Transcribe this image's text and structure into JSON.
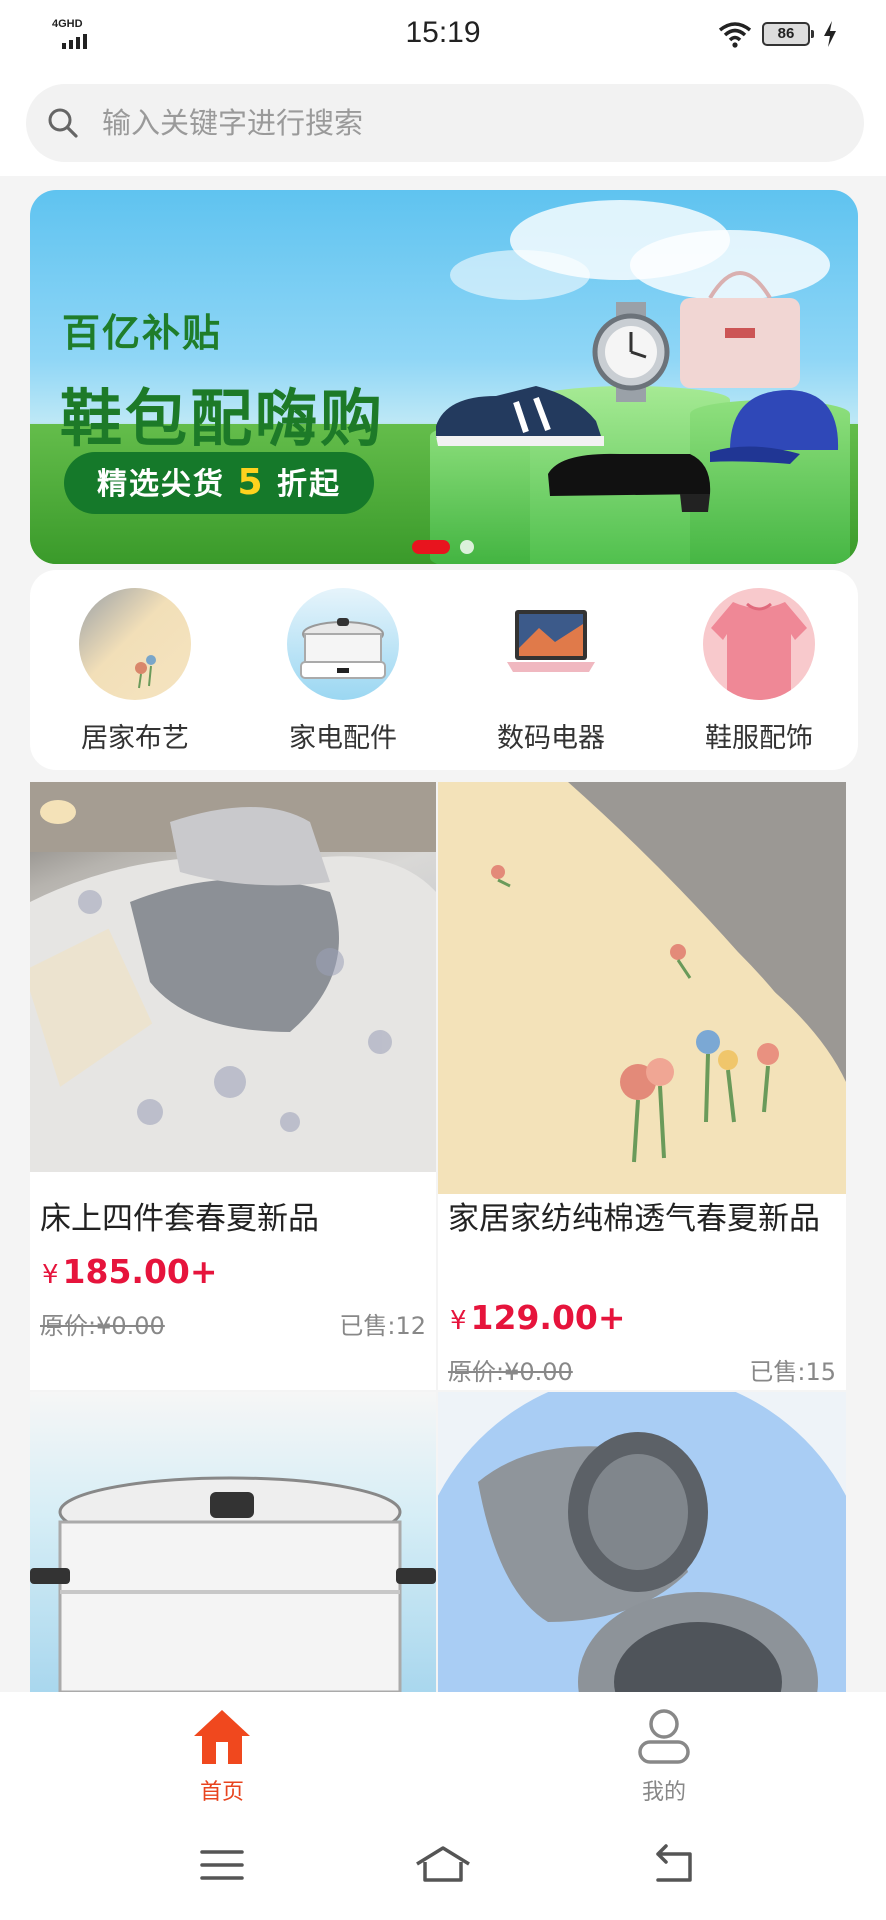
{
  "status_bar": {
    "network": "4GHD",
    "time": "15:19",
    "battery": "86"
  },
  "search": {
    "placeholder": "输入关键字进行搜索"
  },
  "banner": {
    "tag": "百亿补贴",
    "title": "鞋包配嗨购",
    "cta_prefix": "精选尖货",
    "cta_highlight": "5",
    "cta_suffix": "折起",
    "active_slide": 1,
    "slide_count": 2
  },
  "categories": [
    {
      "label": "居家布艺",
      "icon": "bedding-icon"
    },
    {
      "label": "家电配件",
      "icon": "hotpot-icon"
    },
    {
      "label": "数码电器",
      "icon": "laptop-icon"
    },
    {
      "label": "鞋服配饰",
      "icon": "sweater-icon"
    }
  ],
  "products": [
    {
      "title": "床上四件套春夏新品",
      "currency": "¥",
      "price": "185.00+",
      "original_price": "原价:¥0.00",
      "sold": "已售:12"
    },
    {
      "title": "家居家纺纯棉透气春夏新品",
      "currency": "¥",
      "price": "129.00+",
      "original_price": "原价:¥0.00",
      "sold": "已售:15"
    },
    {
      "title": "",
      "image": "cooker"
    },
    {
      "title": "",
      "image": "steel-cups"
    }
  ],
  "tabbar": {
    "home_label": "首页",
    "me_label": "我的"
  },
  "colors": {
    "accent": "#e8441e",
    "price": "#e6143c",
    "banner_green": "#1d7a28"
  }
}
